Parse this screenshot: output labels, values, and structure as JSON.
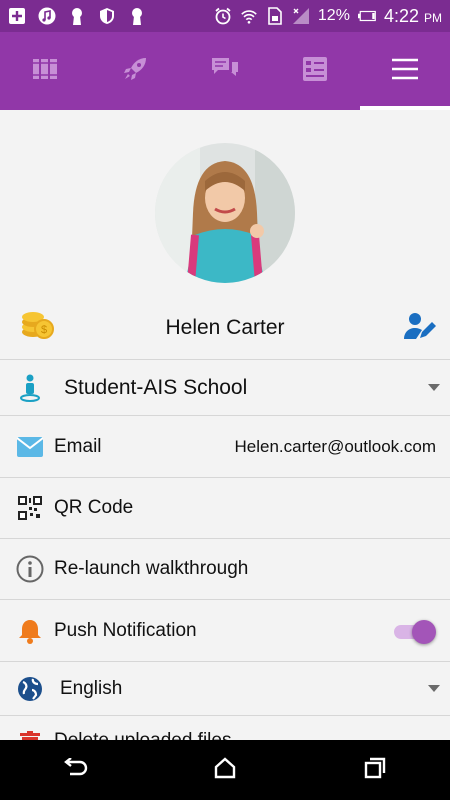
{
  "status_bar": {
    "battery": "12%",
    "time": "4:22",
    "ampm": "PM"
  },
  "nav": {
    "tabs": [
      {
        "icon": "books-icon"
      },
      {
        "icon": "rocket-icon"
      },
      {
        "icon": "chat-icon"
      },
      {
        "icon": "id-card-icon"
      },
      {
        "icon": "hamburger-menu-icon"
      }
    ],
    "active_tab": 4
  },
  "profile": {
    "name": "Helen Carter"
  },
  "settings": {
    "role": "Student-AIS School",
    "email_label": "Email",
    "email_value": "Helen.carter@outlook.com",
    "qr_label": "QR Code",
    "walkthrough_label": "Re-launch walkthrough",
    "push_label": "Push Notification",
    "push_enabled": true,
    "language": "English",
    "partial_label": "Delete uploaded files"
  },
  "colors": {
    "status_bar": "#7b2c91",
    "nav_bar": "#9137a8",
    "accent": "#a355b8"
  }
}
